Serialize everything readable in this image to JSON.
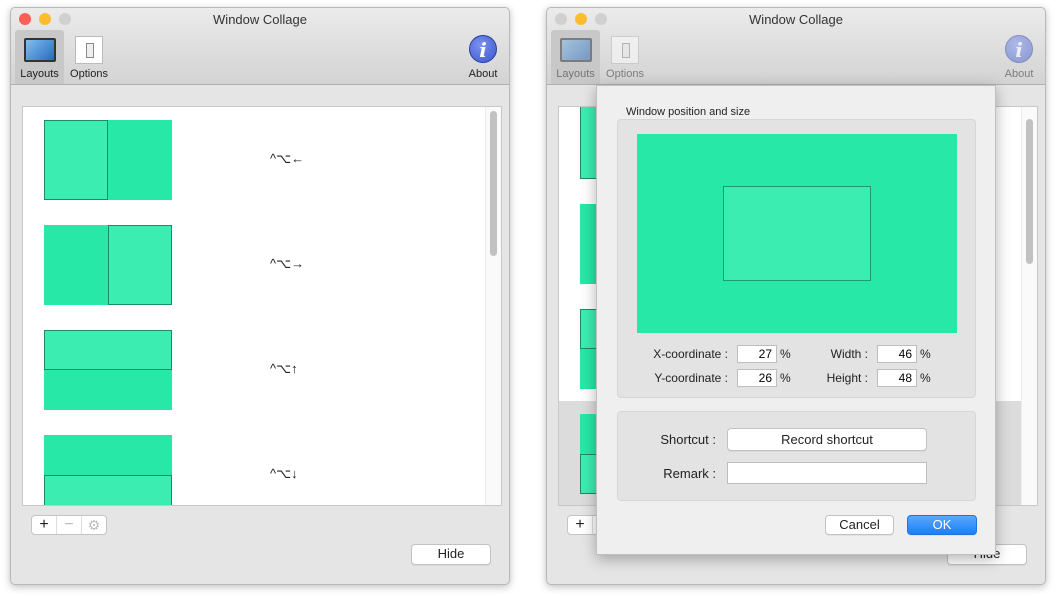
{
  "window_title": "Window Collage",
  "toolbar": {
    "layouts": "Layouts",
    "options": "Options",
    "about": "About"
  },
  "layouts": [
    {
      "highlight": "left-half",
      "shortcut": "^⌥←"
    },
    {
      "highlight": "right-half",
      "shortcut": "^⌥→"
    },
    {
      "highlight": "top-half",
      "shortcut": "^⌥↑"
    },
    {
      "highlight": "bottom-half",
      "shortcut": "^⌥↓"
    }
  ],
  "list_controls": {
    "add": "+",
    "remove": "−",
    "settings_icon": "gear-icon"
  },
  "hide_button": "Hide",
  "dialog": {
    "group_title": "Window position and size",
    "x_label": "X-coordinate :",
    "x_value": "27",
    "y_label": "Y-coordinate :",
    "y_value": "26",
    "width_label": "Width :",
    "width_value": "46",
    "height_label": "Height :",
    "height_value": "48",
    "unit": "%",
    "shortcut_label": "Shortcut :",
    "record_button": "Record shortcut",
    "remark_label": "Remark :",
    "remark_value": "",
    "cancel": "Cancel",
    "ok": "OK"
  },
  "colors": {
    "layout_fill": "#27e8a7",
    "layout_highlight": "#3cedb2",
    "ok_button": "#1a82fb"
  }
}
